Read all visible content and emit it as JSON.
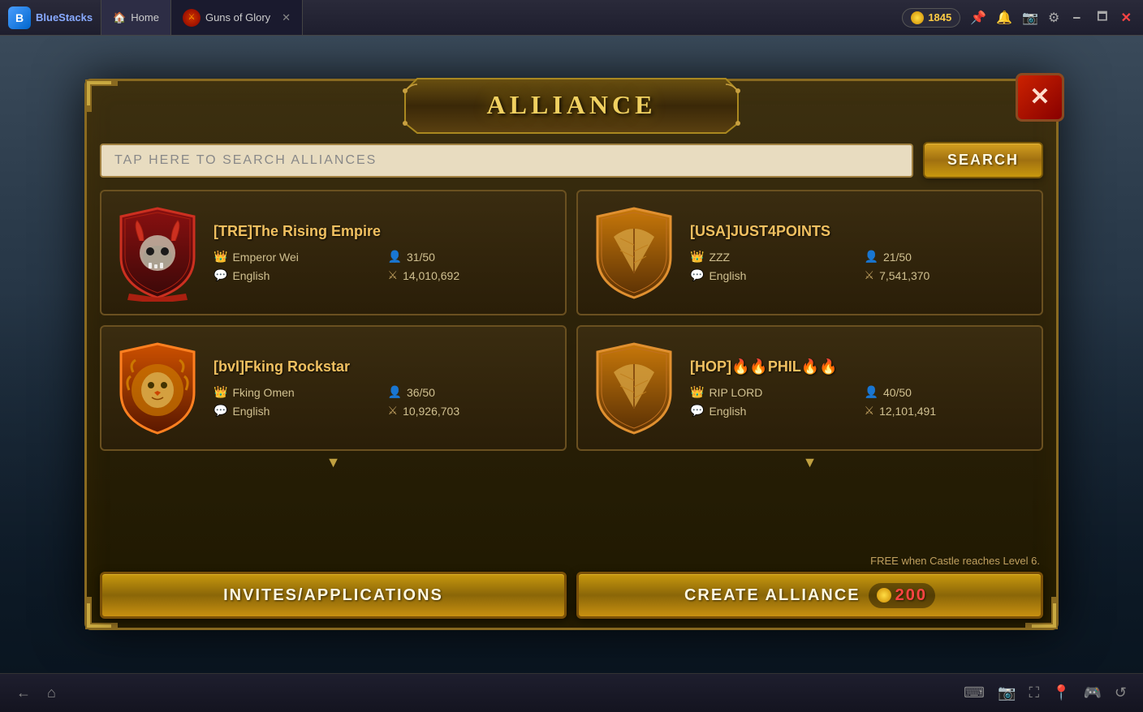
{
  "topbar": {
    "brand": "BlueStacks",
    "home_tab": "Home",
    "game_tab": "Guns of Glory",
    "coins": "1845"
  },
  "title": "ALLIANCE",
  "close_label": "✕",
  "search": {
    "placeholder": "TAP HERE TO SEARCH ALLIANCES",
    "button": "SEARCH"
  },
  "alliances": [
    {
      "id": 1,
      "name": "[TRE]The Rising Empire",
      "leader": "Emperor Wei",
      "language": "English",
      "members": "31/50",
      "power": "14,010,692",
      "badge_type": "dark_red_skull"
    },
    {
      "id": 2,
      "name": "[USA]JUST4POINTS",
      "leader": "ZZZ",
      "language": "English",
      "members": "21/50",
      "power": "7,541,370",
      "badge_type": "bronze_feather"
    },
    {
      "id": 3,
      "name": "[bvl]Fking Rockstar",
      "leader": "Fking Omen",
      "language": "English",
      "members": "36/50",
      "power": "10,926,703",
      "badge_type": "gold_lion"
    },
    {
      "id": 4,
      "name": "[HOP]🔥🔥PHIL🔥🔥",
      "leader": "RIP LORD",
      "language": "English",
      "members": "40/50",
      "power": "12,101,491",
      "badge_type": "bronze_feather"
    }
  ],
  "bottom": {
    "notice": "FREE when Castle reaches Level 6.",
    "invites_btn": "INVITES/APPLICATIONS",
    "create_btn": "CREATE ALLIANCE",
    "create_cost": "200"
  },
  "icons": {
    "leader": "👑",
    "members": "👤",
    "language": "💬",
    "power": "⚔",
    "coin": "🪙"
  }
}
